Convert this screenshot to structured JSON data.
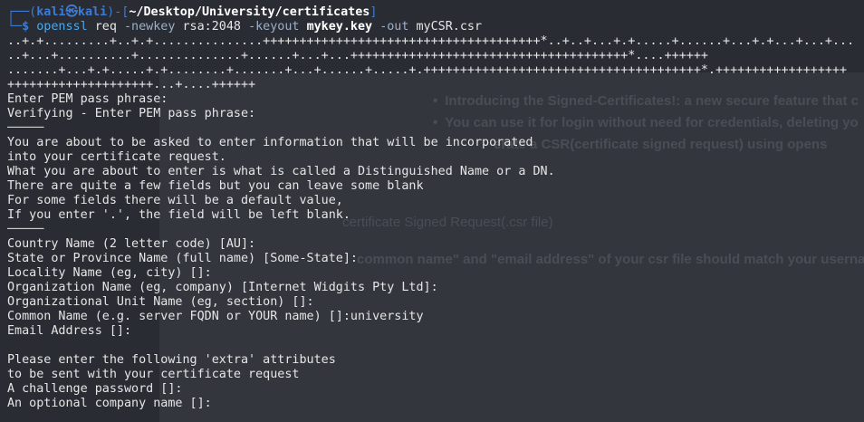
{
  "background_page": {
    "bullets": [
      "Introducing the Signed-Certificates!: a new secure feature that c",
      "You can use it for login without need for credentials, deleting yo",
      "erate a CSR(certificate signed request) using opens"
    ],
    "upload_label": "certificate Signed Request(.csr file)",
    "note": "common name\" and \"email address\" of your csr file should match your usernar"
  },
  "prompt": {
    "frame_top": "┌──(",
    "user": "kali",
    "at_symbol": "㉿",
    "host": "kali",
    "mid": ")-[",
    "path": "~/Desktop/University/certificates",
    "close": "]",
    "frame_bottom": "└─",
    "dollar": "$"
  },
  "command": {
    "program": "openssl",
    "sub": "req",
    "opt_newkey": "-newkey",
    "newkey_val": "rsa:2048",
    "opt_keyout": "-keyout",
    "keyout_val": "mykey.key",
    "opt_out": "-out",
    "out_val": "myCSR.csr"
  },
  "output_lines": [
    "..+.+.........+..+.+...............++++++++++++++++++++++++++++++++++++++*..+..+...+.+.....+......+...+.+...+...+...",
    "..+...+..........+..............+......+...+...++++++++++++++++++++++++++++++++++++++*....++++++",
    ".......+...+.+.....+.+........+.......+...+......+.....+.++++++++++++++++++++++++++++++++++++++*.++++++++++++++++++",
    "++++++++++++++++++++...+....++++++",
    "Enter PEM pass phrase:",
    "Verifying - Enter PEM pass phrase:",
    "─────",
    "You are about to be asked to enter information that will be incorporated",
    "into your certificate request.",
    "What you are about to enter is what is called a Distinguished Name or a DN.",
    "There are quite a few fields but you can leave some blank",
    "For some fields there will be a default value,",
    "If you enter '.', the field will be left blank.",
    "─────",
    "Country Name (2 letter code) [AU]:",
    "State or Province Name (full name) [Some-State]:",
    "Locality Name (eg, city) []:",
    "Organization Name (eg, company) [Internet Widgits Pty Ltd]:",
    "Organizational Unit Name (eg, section) []:",
    "Common Name (e.g. server FQDN or YOUR name) []:university",
    "Email Address []:",
    "",
    "Please enter the following 'extra' attributes",
    "to be sent with your certificate request",
    "A challenge password []:",
    "An optional company name []:"
  ]
}
